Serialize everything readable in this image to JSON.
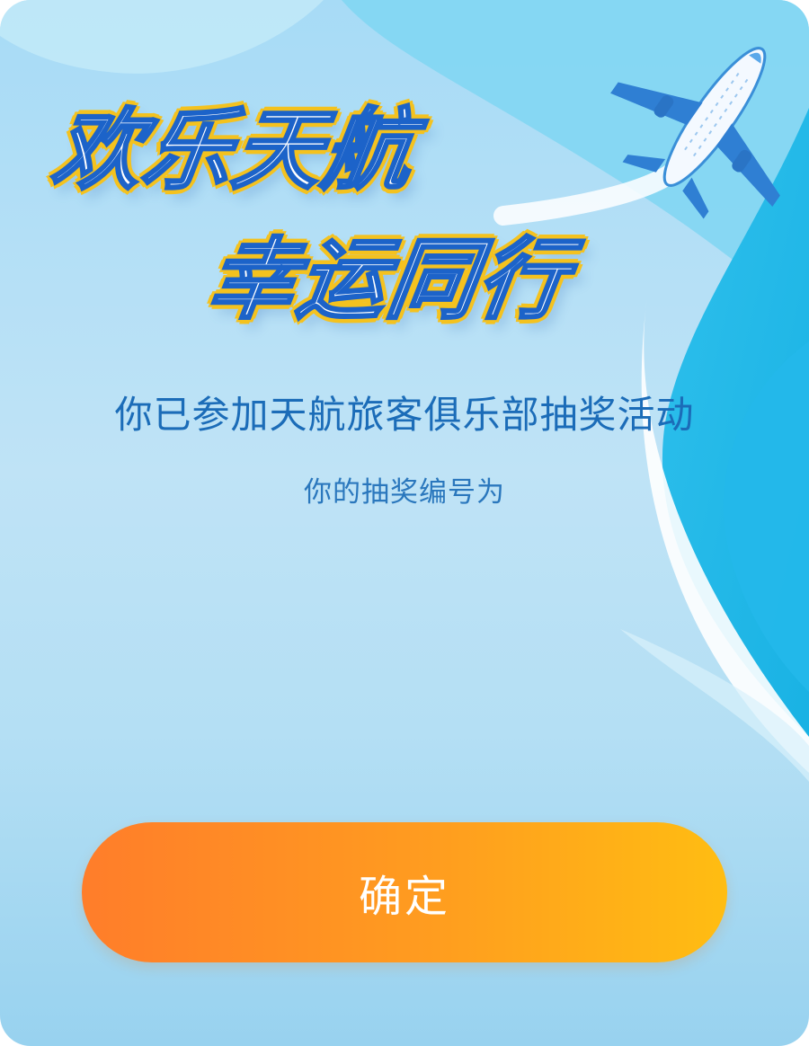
{
  "headline": {
    "line1": "欢乐天航",
    "line2": "幸运同行"
  },
  "subtitle": "你已参加天航旅客俱乐部抽奖活动",
  "lottery_label": "你的抽奖编号为",
  "lottery_number": "",
  "confirm_button": "确定",
  "colors": {
    "accent_orange_start": "#ff7d2a",
    "accent_orange_end": "#ffbd12",
    "text_blue": "#1b6cb8",
    "headline_outline": "#f4c21f"
  }
}
